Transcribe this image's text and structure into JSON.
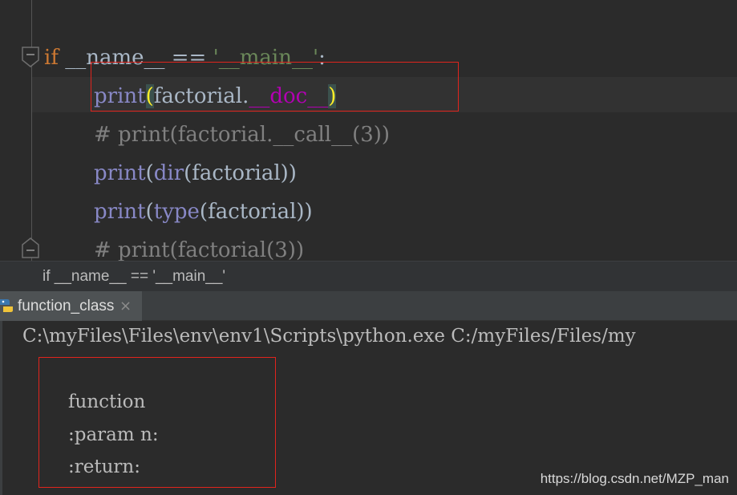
{
  "editor": {
    "lines": {
      "l1": {
        "kw": "if",
        "name": " __name__ == ",
        "str": "'__main__'",
        "colon": ":"
      },
      "l2": {
        "fn": "print",
        "open": "(",
        "obj": "factorial.",
        "attr": "__doc__",
        "close": ")"
      },
      "l3": {
        "comment": "# print(factorial.__call__(3))"
      },
      "l4": {
        "fn": "print",
        "open": "(",
        "fn2": "dir",
        "rest": "(factorial))"
      },
      "l5": {
        "fn": "print",
        "open": "(",
        "fn2": "type",
        "rest": "(factorial))"
      },
      "l6": {
        "comment": "# print(factorial(3))"
      }
    }
  },
  "breadcrumb": {
    "text": "if __name__ == '__main__'"
  },
  "run_tab": {
    "label": "function_class",
    "close": "×",
    "icon": "python-icon"
  },
  "console": {
    "command": "C:\\myFiles\\Files\\env\\env1\\Scripts\\python.exe C:/myFiles/Files/my",
    "output": [
      "function",
      ":param n:",
      ":return:"
    ]
  },
  "watermark": "https://blog.csdn.net/MZP_man",
  "colors": {
    "keyword": "#cc7832",
    "string": "#6a8759",
    "builtin": "#8888c6",
    "dunder": "#b200b2",
    "comment": "#808080",
    "highlight_box": "#e0241d"
  }
}
